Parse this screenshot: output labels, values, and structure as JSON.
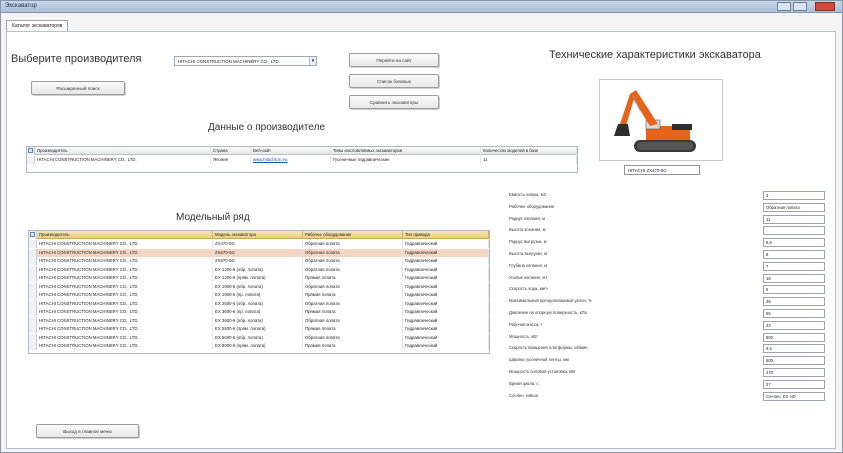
{
  "window": {
    "title": "Экскаватор"
  },
  "tab": {
    "label": "Каталог экскаваторов"
  },
  "manufacturer_select": {
    "heading": "Выберите производителя",
    "value": "HITACHI CONSTRUCTION MACHINERY CO., LTD."
  },
  "buttons": {
    "advanced_search": "Расширенный поиск",
    "go_to_site": "Перейти на сайт",
    "list_excavators": "Список базовых",
    "compare_excavators": "Сравнить экскаваторы",
    "exit_main_menu": "Выход в главное меню"
  },
  "manufacturer_data": {
    "heading": "Данные о производителе",
    "columns": [
      "Производитель",
      "Страна",
      "Веб-сайт",
      "Типы изготовляемых экскаваторов",
      "Количество моделей в базе"
    ],
    "row": [
      "HITACHI CONSTRUCTION MACHINERY CO., LTD.",
      "Япония",
      "www.hitachicm.eu",
      "Гусеничные гидравлические",
      "11"
    ]
  },
  "model_range": {
    "heading": "Модельный ряд",
    "columns": [
      "Производитель",
      "Модель экскаватора",
      "Рабочее оборудование",
      "Тип привода"
    ],
    "rows": [
      [
        "HITACHI CONSTRUCTION MACHINERY CO., LTD.",
        "ZX470-5G",
        "Обратная лопата",
        "Гидравлический"
      ],
      [
        "HITACHI CONSTRUCTION MACHINERY CO., LTD.",
        "ZX670-5G",
        "Обратная лопата",
        "Гидравлический"
      ],
      [
        "HITACHI CONSTRUCTION MACHINERY CO., LTD.",
        "ZX870-5G",
        "Обратная лопата",
        "Гидравлический"
      ],
      [
        "HITACHI CONSTRUCTION MACHINERY CO., LTD.",
        "EX 1200-6 (обр. лопата)",
        "Обратная лопата",
        "Гидравлический"
      ],
      [
        "HITACHI CONSTRUCTION MACHINERY CO., LTD.",
        "EX 1200-6 (прям. лопата)",
        "Прямая лопата",
        "Гидравлический"
      ],
      [
        "HITACHI CONSTRUCTION MACHINERY CO., LTD.",
        "EX 1900-6 (обр. лопата)",
        "Обратная лопата",
        "Гидравлический"
      ],
      [
        "HITACHI CONSTRUCTION MACHINERY CO., LTD.",
        "EX 1900-6 (пр. лопата)",
        "Прямая лопата",
        "Гидравлический"
      ],
      [
        "HITACHI CONSTRUCTION MACHINERY CO., LTD.",
        "EX 2600-6 (обр. лопата)",
        "Обратная лопата",
        "Гидравлический"
      ],
      [
        "HITACHI CONSTRUCTION MACHINERY CO., LTD.",
        "EX 3600-6 (пр. лопата)",
        "Прямая лопата",
        "Гидравлический"
      ],
      [
        "HITACHI CONSTRUCTION MACHINERY CO., LTD.",
        "EX 3600-6 (обр. лопата)",
        "Обратная лопата",
        "Гидравлический"
      ],
      [
        "HITACHI CONSTRUCTION MACHINERY CO., LTD.",
        "EX 5600-6 (прям. лопата)",
        "Прямая лопата",
        "Гидравлический"
      ],
      [
        "HITACHI CONSTRUCTION MACHINERY CO., LTD.",
        "EX 5600-6 (обр. лопата)",
        "Обратная лопата",
        "Гидравлический"
      ],
      [
        "HITACHI CONSTRUCTION MACHINERY CO., LTD.",
        "EX 8000-6 (прям. лопата)",
        "Прямая лопата",
        "Гидравлический"
      ]
    ],
    "selected_row": 1
  },
  "tech_specs": {
    "heading": "Технические характеристики экскаватора",
    "model": "HITACHI ZX470-5G",
    "labels": [
      "Емкость ковша, м3",
      "Рабочее оборудование",
      "Радиус копания, м",
      "Высота копания, м",
      "Радиус выгрузки, м",
      "Высота выгрузки, м",
      "Глубина копания, м",
      "Усилие копания, кН",
      "Скорость хода, км/ч",
      "Максимальный преодолеваемый уклон, %",
      "Давление на опорную поверхность, кПа",
      "Рабочая масса, т",
      "Мощность, кВт",
      "Скорость вращения платформы, об/мин",
      "Ширина гусеничной ленты, мм",
      "Мощность силовой установки, кВт",
      "Время цикла, с",
      "Сочлен. ковша"
    ],
    "values": [
      "3",
      "Обратная лопата",
      "11",
      "",
      "8.5",
      "8",
      "7",
      "16",
      "5",
      "35",
      "55",
      "33",
      "600",
      "9.2",
      "600",
      "270",
      "27",
      "Сочлен. EX HD"
    ]
  },
  "icons": {
    "minimize": "minimize-icon",
    "maximize": "maximize-icon",
    "close": "close-icon",
    "dropdown": "chevron-down-icon",
    "excavator": "excavator-image"
  },
  "colors": {
    "grid_header": "#e9cf80",
    "selected_row": "#f3d5c3",
    "excavator_orange": "#e8631a"
  }
}
